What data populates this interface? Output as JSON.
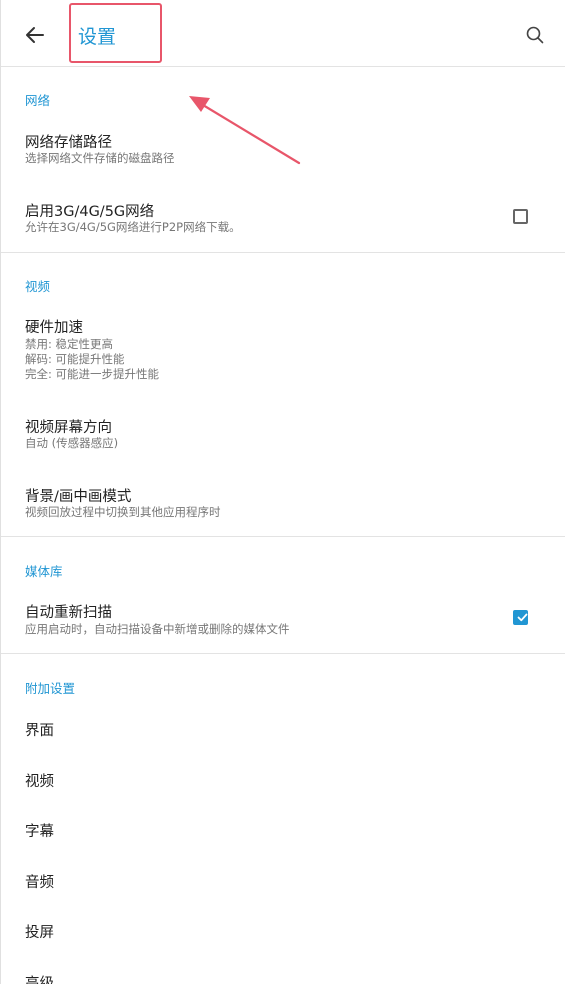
{
  "header": {
    "title": "设置",
    "back_icon": "arrow-left-icon",
    "search_icon": "search-icon"
  },
  "network": {
    "header": "网络",
    "storage_path": {
      "title": "网络存储路径",
      "subtitle": "选择网络文件存储的磁盘路径"
    },
    "mobile_network": {
      "title": "启用3G/4G/5G网络",
      "subtitle": "允许在3G/4G/5G网络进行P2P网络下载。",
      "checked": false
    }
  },
  "video": {
    "header": "视频",
    "hw_accel": {
      "title": "硬件加速",
      "subtitle_lines": [
        "禁用: 稳定性更高",
        "解码: 可能提升性能",
        "完全: 可能进一步提升性能"
      ]
    },
    "orientation": {
      "title": "视频屏幕方向",
      "subtitle": "自动 (传感器感应)"
    },
    "pip": {
      "title": "背景/画中画模式",
      "subtitle": "视频回放过程中切换到其他应用程序时"
    }
  },
  "media": {
    "header": "媒体库",
    "auto_rescan": {
      "title": "自动重新扫描",
      "subtitle": "应用启动时，自动扫描设备中新增或删除的媒体文件",
      "checked": true
    }
  },
  "extra": {
    "header": "附加设置",
    "items": [
      "界面",
      "视频",
      "字幕",
      "音频",
      "投屏",
      "高级"
    ]
  },
  "colors": {
    "accent": "#2196d3",
    "annotation": "#e8566a"
  }
}
